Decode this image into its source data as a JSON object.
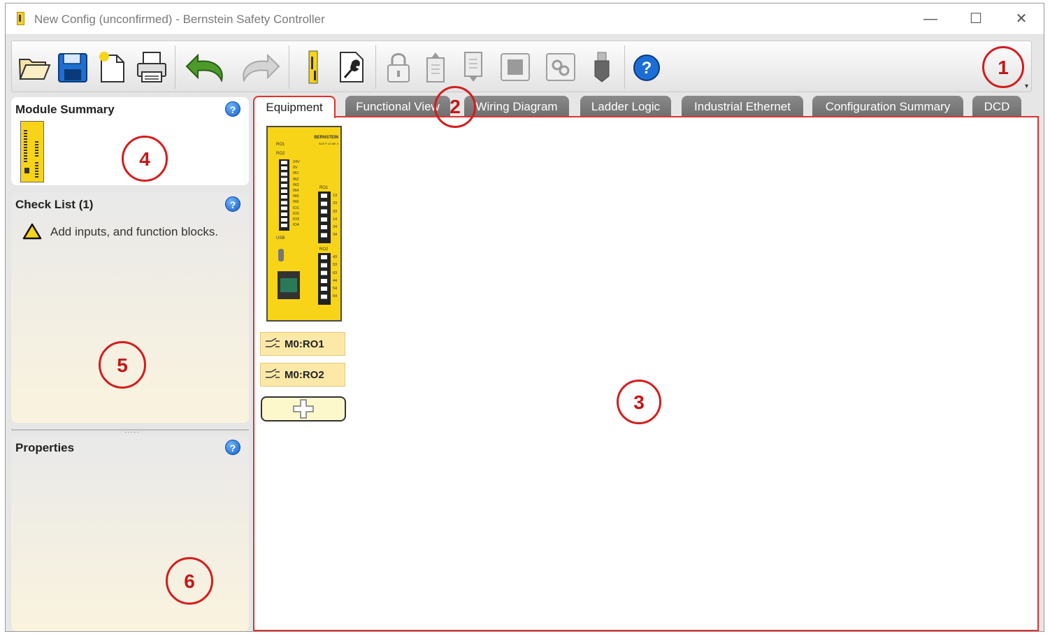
{
  "window": {
    "title": "New Config (unconfirmed) - Bernstein Safety Controller",
    "controls": {
      "minimize": "—",
      "maximize": "☐",
      "close": "✕"
    }
  },
  "toolbar": {
    "buttons": [
      {
        "name": "open-folder-icon"
      },
      {
        "name": "save-icon"
      },
      {
        "name": "new-config-icon"
      },
      {
        "name": "print-icon"
      },
      {
        "name": "undo-icon"
      },
      {
        "name": "redo-icon"
      },
      {
        "name": "module-icon"
      },
      {
        "name": "settings-wrench-icon"
      },
      {
        "name": "lock-icon"
      },
      {
        "name": "upload-icon"
      },
      {
        "name": "download-icon"
      },
      {
        "name": "chip-icon"
      },
      {
        "name": "link-icon"
      },
      {
        "name": "usb-icon"
      },
      {
        "name": "help-icon"
      }
    ],
    "overflow": "▾"
  },
  "tabs": [
    {
      "label": "Equipment",
      "active": true
    },
    {
      "label": "Functional View",
      "active": false
    },
    {
      "label": "Wiring Diagram",
      "active": false
    },
    {
      "label": "Ladder Logic",
      "active": false
    },
    {
      "label": "Industrial Ethernet",
      "active": false
    },
    {
      "label": "Configuration Summary",
      "active": false
    },
    {
      "label": "DCD",
      "active": false
    }
  ],
  "panels": {
    "module_summary": {
      "title": "Module Summary",
      "help": "?"
    },
    "check_list": {
      "title": "Check List (1)",
      "help": "?",
      "items": [
        {
          "icon": "warning-icon",
          "text": "Add inputs, and function blocks."
        }
      ]
    },
    "properties": {
      "title": "Properties",
      "help": "?"
    },
    "splitter_grip": "·····"
  },
  "equipment": {
    "module": {
      "brand": "BERNSTEIN",
      "model": "SCR P 16 ME 4",
      "relay_labels": [
        "RO1",
        "RO2"
      ],
      "input_labels": [
        "24V",
        "0V",
        "IN1",
        "IN2",
        "IN3",
        "IN4",
        "IN5",
        "IN6",
        "IO1",
        "IO2",
        "IO3",
        "IO4"
      ],
      "ro1_terminals": [
        "13",
        "23",
        "33",
        "14",
        "24",
        "34"
      ],
      "ro2_terminals": [
        "43",
        "53",
        "63",
        "44",
        "54",
        "64"
      ],
      "usb_label": "USB"
    },
    "relays": [
      {
        "label": "M0:RO1"
      },
      {
        "label": "M0:RO2"
      }
    ],
    "add_button": "+"
  },
  "callouts": [
    "1",
    "2",
    "3",
    "4",
    "5",
    "6"
  ],
  "colors": {
    "callout_red": "#d51c1c",
    "module_yellow": "#f7d418",
    "tab_gray": "#7a7a7a",
    "help_blue": "#1560c8"
  }
}
